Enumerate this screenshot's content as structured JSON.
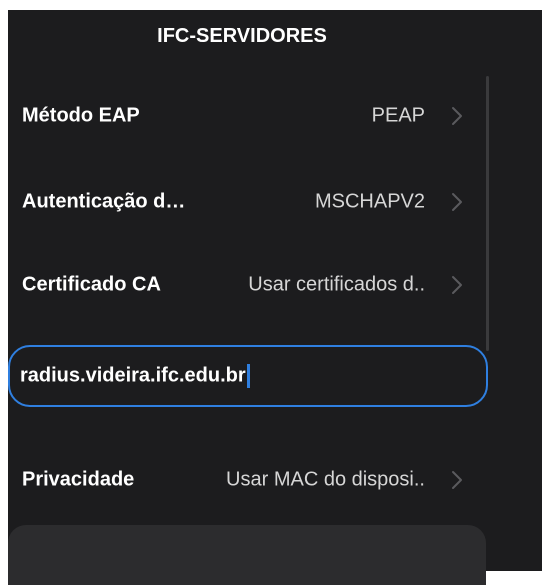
{
  "header": {
    "title": "IFC-SERVIDORES"
  },
  "settings": {
    "rows": [
      {
        "label": "Método EAP",
        "value": "PEAP",
        "icon": "chevron-right-icon"
      },
      {
        "label": "Autenticação d…",
        "value": "MSCHAPV2",
        "icon": "chevron-right-icon"
      },
      {
        "label": "Certificado CA",
        "value": "Usar certificados d..",
        "icon": "chevron-right-icon"
      }
    ],
    "domain_field": {
      "value": "radius.videira.ifc.edu.br"
    },
    "privacy": {
      "label": "Privacidade",
      "value": "Usar MAC do disposi..",
      "icon": "chevron-right-icon"
    }
  },
  "colors": {
    "background": "#1c1c1e",
    "accent": "#2f7fe0",
    "text": "#ffffff",
    "secondary_text": "#d6d6d6",
    "chevron": "#5a5a5e",
    "panel": "#2c2c2e"
  }
}
